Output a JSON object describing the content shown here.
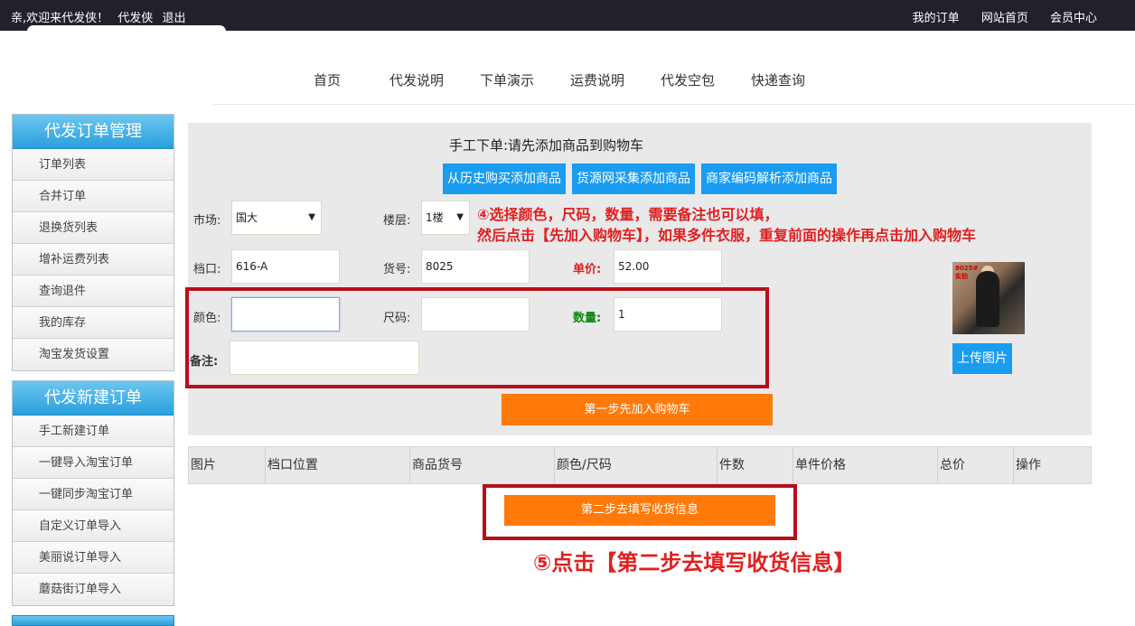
{
  "topbar": {
    "welcome": "亲,欢迎来代发侠！",
    "username": "代发侠",
    "logout": "退出",
    "links": [
      "我的订单",
      "网站首页",
      "会员中心"
    ]
  },
  "nav": [
    "首页",
    "代发说明",
    "下单演示",
    "运费说明",
    "代发空包",
    "快递查询"
  ],
  "sidebar": {
    "groups": [
      {
        "title": "代发订单管理",
        "items": [
          "订单列表",
          "合并订单",
          "退换货列表",
          "增补运费列表",
          "查询退件",
          "我的库存",
          "淘宝发货设置"
        ]
      },
      {
        "title": "代发新建订单",
        "items": [
          "手工新建订单",
          "一键导入淘宝订单",
          "一键同步淘宝订单",
          "自定义订单导入",
          "美丽说订单导入",
          "蘑菇街订单导入"
        ]
      }
    ]
  },
  "form": {
    "title": "手工下单:请先添加商品到购物车",
    "add_buttons": [
      "从历史购买添加商品",
      "货源网采集添加商品",
      "商家编码解析添加商品"
    ],
    "market_label": "市场:",
    "market_value": "国大",
    "floor_label": "楼层:",
    "floor_value": "1楼",
    "stall_label": "档口:",
    "stall_value": "616-A",
    "sku_label": "货号:",
    "sku_value": "8025",
    "price_label": "单价:",
    "price_value": "52.00",
    "color_label": "颜色:",
    "color_value": "",
    "size_label": "尺码:",
    "size_value": "",
    "qty_label": "数量:",
    "qty_value": "1",
    "remark_label": "备注:",
    "remark_value": "",
    "note_line1": "④选择颜色，尺码，数量，需要备注也可以填，",
    "note_line2": "然后点击【先加入购物车】，如果多件衣服，重复前面的操作再点击加入购物车",
    "thumb_tag": "8025#\n实拍",
    "upload_label": "上传图片",
    "cart_button": "第一步先加入购物车"
  },
  "table": {
    "columns": [
      "图片",
      "档口位置",
      "商品货号",
      "颜色/尺码",
      "件数",
      "单件价格",
      "总价",
      "操作"
    ]
  },
  "step2_button": "第二步去填写收货信息",
  "step5_note": "⑤点击【第二步去填写收货信息】",
  "colors": {
    "accent_blue": "#1a9cf0",
    "orange": "#ff7a0a",
    "annotation_red": "#e02020",
    "topbar": "#22202b"
  }
}
